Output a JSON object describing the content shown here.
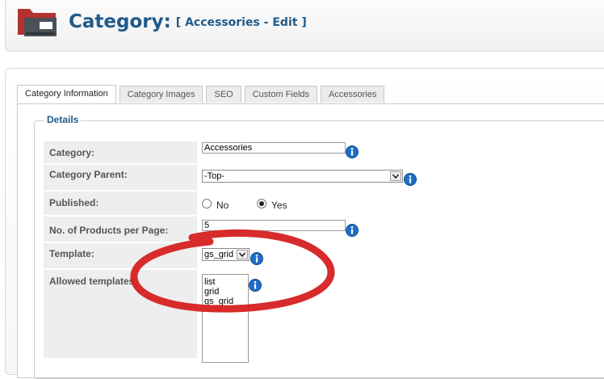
{
  "header": {
    "title": "Category:",
    "subtitle": "[ Accessories - Edit ]",
    "icon": "category-folder-icon"
  },
  "tabs": [
    {
      "label": "Category Information",
      "active": true
    },
    {
      "label": "Category Images",
      "active": false
    },
    {
      "label": "SEO",
      "active": false
    },
    {
      "label": "Custom Fields",
      "active": false
    },
    {
      "label": "Accessories",
      "active": false
    }
  ],
  "details": {
    "legend": "Details",
    "category": {
      "label": "Category:",
      "value": "Accessories"
    },
    "category_parent": {
      "label": "Category Parent:",
      "selected": "-Top-"
    },
    "published": {
      "label": "Published:",
      "options": [
        "No",
        "Yes"
      ],
      "selected": "Yes"
    },
    "products_per_page": {
      "label": "No. of Products per Page:",
      "value": "5"
    },
    "template": {
      "label": "Template:",
      "selected": "gs_grid"
    },
    "allowed_templates": {
      "label": "Allowed templates:",
      "options": [
        "list",
        "grid",
        "gs_grid"
      ]
    }
  },
  "colors": {
    "accent": "#1f5a8a",
    "annotation": "#d62020",
    "info_icon": "#1e6fc4"
  }
}
